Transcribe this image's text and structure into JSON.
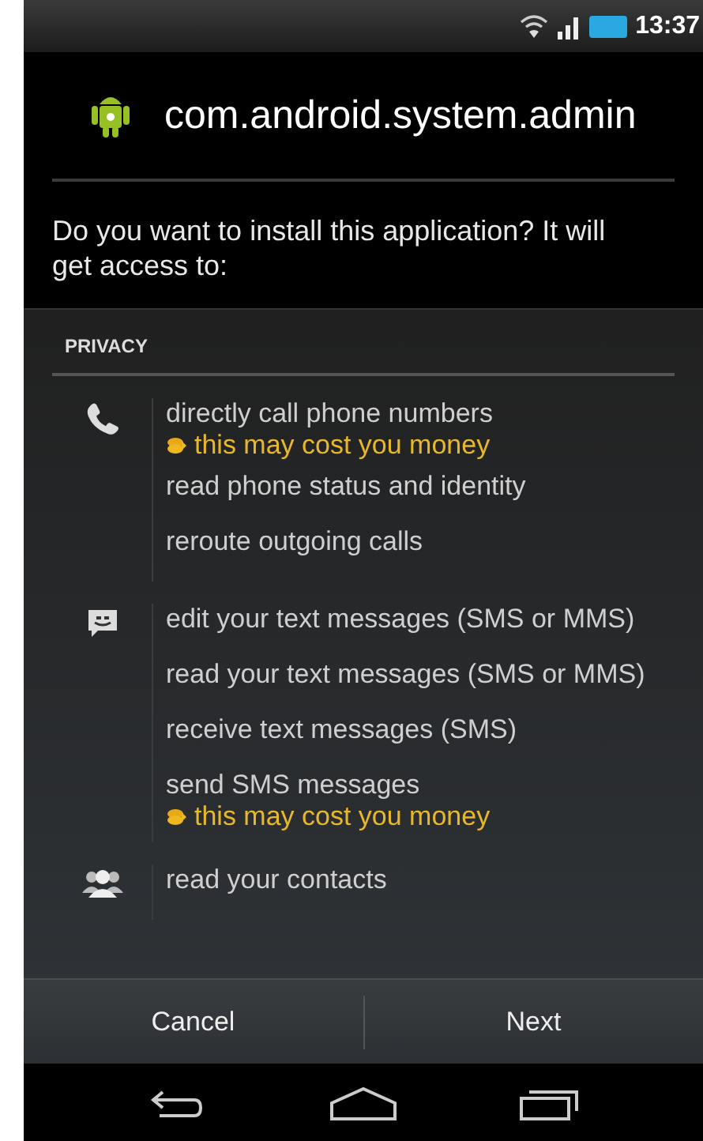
{
  "status_bar": {
    "time": "13:37"
  },
  "app": {
    "name": "com.android.system.admin"
  },
  "prompt": "Do you want to install this application? It will get access to:",
  "section": {
    "title": "PRIVACY"
  },
  "groups": [
    {
      "kind": "phone",
      "permissions": [
        {
          "text": "directly call phone numbers",
          "warning": "this may cost you money"
        },
        {
          "text": "read phone status and identity"
        },
        {
          "text": "reroute outgoing calls"
        }
      ]
    },
    {
      "kind": "message",
      "permissions": [
        {
          "text": "edit your text messages (SMS or MMS)"
        },
        {
          "text": "read your text messages (SMS or MMS)"
        },
        {
          "text": "receive text messages (SMS)"
        },
        {
          "text": "send SMS messages",
          "warning": "this may cost you money"
        }
      ]
    },
    {
      "kind": "contacts",
      "permissions": [
        {
          "text": "read your contacts"
        }
      ]
    }
  ],
  "buttons": [
    {
      "label": "Cancel"
    },
    {
      "label": "Next"
    }
  ]
}
